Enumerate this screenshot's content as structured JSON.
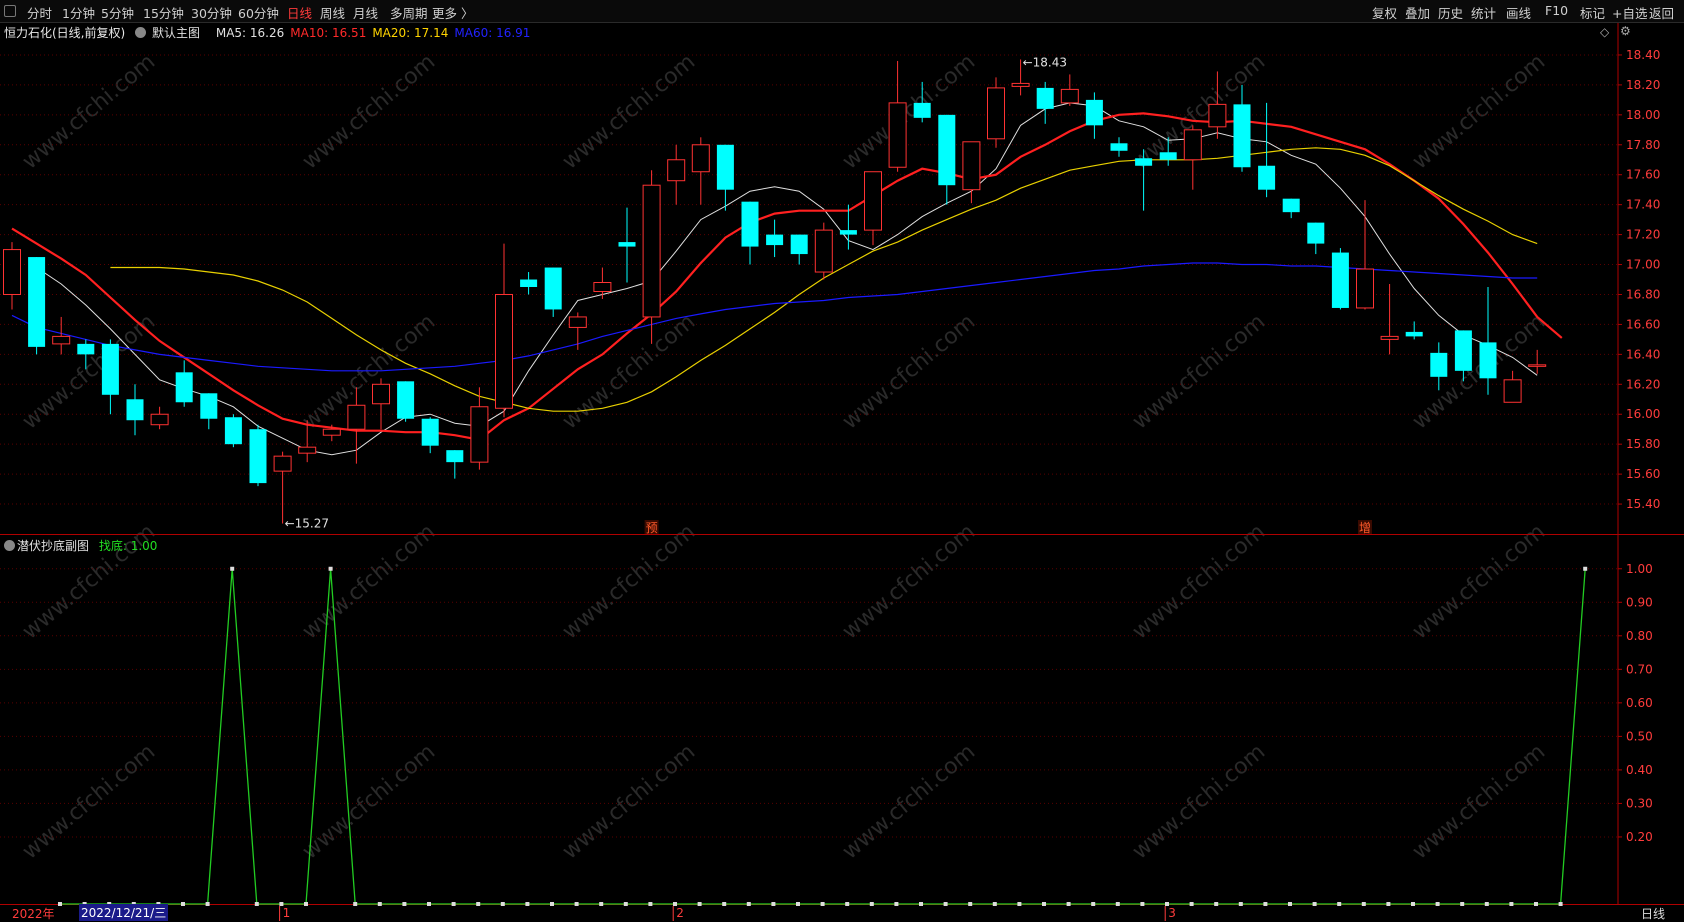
{
  "toolbar": {
    "periods": [
      "分时",
      "1分钟",
      "5分钟",
      "15分钟",
      "30分钟",
      "60分钟",
      "日线",
      "周线",
      "月线",
      "多周期",
      "更多 〉"
    ],
    "active_period": "日线",
    "right_buttons": [
      "复权",
      "叠加",
      "历史",
      "统计",
      "画线",
      "F10",
      "标记",
      "+自选",
      "返回"
    ]
  },
  "main_panel": {
    "stock_name": "恒力石化(日线,前复权)",
    "indicator_name": "默认主图",
    "ma_labels": [
      {
        "text": "MA5: 16.26",
        "color": "#e0e0e0"
      },
      {
        "text": "MA10: 16.51",
        "color": "#ff2a2a"
      },
      {
        "text": "MA20: 17.14",
        "color": "#ffd400"
      },
      {
        "text": "MA60: 16.91",
        "color": "#2222ff"
      }
    ],
    "high_marker": "18.43",
    "low_marker": "15.27",
    "event_markers": [
      "预",
      "增"
    ]
  },
  "sub_panel": {
    "indicator_name": "潜伏抄底副图",
    "value_label": "找底: 1.00"
  },
  "bottom_bar": {
    "year_label": "2022年",
    "cursor_date": "2022/12/21/三",
    "month_labels": [
      "1",
      "2",
      "3"
    ],
    "period_label": "日线"
  },
  "watermark": "www.cfchi.com",
  "colors": {
    "up_candle": "#ff3232",
    "down_candle": "#00ffff",
    "ma5": "#e0e0e0",
    "ma10": "#ff2020",
    "ma20": "#e8d000",
    "ma60": "#1a1aff",
    "signal_line": "#22cc22",
    "grid": "#8b0000",
    "axis_text": "#ff3c3c"
  },
  "chart_data": [
    {
      "type": "candlestick",
      "title": "恒力石化(日线,前复权)",
      "ylim": [
        15.2,
        18.5
      ],
      "yticks": [
        15.4,
        15.6,
        15.8,
        16.0,
        16.2,
        16.4,
        16.6,
        16.8,
        17.0,
        17.2,
        17.4,
        17.6,
        17.8,
        18.0,
        18.2,
        18.4
      ],
      "x_month_labels": [
        {
          "label": "1",
          "index": 11
        },
        {
          "label": "2",
          "index": 27
        },
        {
          "label": "3",
          "index": 47
        }
      ],
      "events": [
        {
          "label": "预",
          "index": 26
        },
        {
          "label": "增",
          "index": 55
        }
      ],
      "candles": [
        {
          "o": 16.8,
          "h": 17.15,
          "l": 16.7,
          "c": 17.1
        },
        {
          "o": 17.05,
          "h": 17.05,
          "l": 16.4,
          "c": 16.45
        },
        {
          "o": 16.47,
          "h": 16.65,
          "l": 16.4,
          "c": 16.52
        },
        {
          "o": 16.47,
          "h": 16.5,
          "l": 16.3,
          "c": 16.4
        },
        {
          "o": 16.47,
          "h": 16.5,
          "l": 16.0,
          "c": 16.13
        },
        {
          "o": 16.1,
          "h": 16.2,
          "l": 15.86,
          "c": 15.96
        },
        {
          "o": 15.93,
          "h": 16.05,
          "l": 15.9,
          "c": 16.0
        },
        {
          "o": 16.28,
          "h": 16.36,
          "l": 16.05,
          "c": 16.08
        },
        {
          "o": 16.14,
          "h": 16.14,
          "l": 15.9,
          "c": 15.97
        },
        {
          "o": 15.98,
          "h": 16.0,
          "l": 15.78,
          "c": 15.8
        },
        {
          "o": 15.9,
          "h": 15.93,
          "l": 15.52,
          "c": 15.54
        },
        {
          "o": 15.62,
          "h": 15.75,
          "l": 15.27,
          "c": 15.72
        },
        {
          "o": 15.74,
          "h": 15.96,
          "l": 15.68,
          "c": 15.78
        },
        {
          "o": 15.86,
          "h": 15.93,
          "l": 15.82,
          "c": 15.9
        },
        {
          "o": 15.9,
          "h": 16.18,
          "l": 15.67,
          "c": 16.06
        },
        {
          "o": 16.07,
          "h": 16.24,
          "l": 15.9,
          "c": 16.2
        },
        {
          "o": 16.22,
          "h": 16.22,
          "l": 15.95,
          "c": 15.97
        },
        {
          "o": 15.97,
          "h": 15.98,
          "l": 15.74,
          "c": 15.79
        },
        {
          "o": 15.76,
          "h": 15.76,
          "l": 15.57,
          "c": 15.68
        },
        {
          "o": 15.68,
          "h": 16.18,
          "l": 15.63,
          "c": 16.05
        },
        {
          "o": 16.04,
          "h": 17.14,
          "l": 15.98,
          "c": 16.8
        },
        {
          "o": 16.9,
          "h": 16.95,
          "l": 16.8,
          "c": 16.85
        },
        {
          "o": 16.98,
          "h": 16.98,
          "l": 16.65,
          "c": 16.7
        },
        {
          "o": 16.58,
          "h": 16.68,
          "l": 16.43,
          "c": 16.65
        },
        {
          "o": 16.82,
          "h": 16.98,
          "l": 16.77,
          "c": 16.88
        },
        {
          "o": 17.15,
          "h": 17.38,
          "l": 16.88,
          "c": 17.12
        },
        {
          "o": 16.65,
          "h": 17.63,
          "l": 16.47,
          "c": 17.53
        },
        {
          "o": 17.56,
          "h": 17.8,
          "l": 17.4,
          "c": 17.7
        },
        {
          "o": 17.62,
          "h": 17.85,
          "l": 17.4,
          "c": 17.8
        },
        {
          "o": 17.8,
          "h": 17.8,
          "l": 17.36,
          "c": 17.5
        },
        {
          "o": 17.42,
          "h": 17.42,
          "l": 17.0,
          "c": 17.12
        },
        {
          "o": 17.2,
          "h": 17.3,
          "l": 17.05,
          "c": 17.13
        },
        {
          "o": 17.2,
          "h": 17.2,
          "l": 17.0,
          "c": 17.07
        },
        {
          "o": 16.95,
          "h": 17.28,
          "l": 16.9,
          "c": 17.23
        },
        {
          "o": 17.23,
          "h": 17.4,
          "l": 17.1,
          "c": 17.2
        },
        {
          "o": 17.23,
          "h": 17.62,
          "l": 17.13,
          "c": 17.62
        },
        {
          "o": 17.65,
          "h": 18.36,
          "l": 17.62,
          "c": 18.08
        },
        {
          "o": 18.08,
          "h": 18.22,
          "l": 17.95,
          "c": 17.98
        },
        {
          "o": 18.0,
          "h": 18.0,
          "l": 17.4,
          "c": 17.53
        },
        {
          "o": 17.5,
          "h": 17.82,
          "l": 17.41,
          "c": 17.82
        },
        {
          "o": 17.84,
          "h": 18.25,
          "l": 17.78,
          "c": 18.18
        },
        {
          "o": 18.19,
          "h": 18.37,
          "l": 18.13,
          "c": 18.21
        },
        {
          "o": 18.18,
          "h": 18.22,
          "l": 17.94,
          "c": 18.04
        },
        {
          "o": 18.08,
          "h": 18.27,
          "l": 18.06,
          "c": 18.17
        },
        {
          "o": 18.1,
          "h": 18.15,
          "l": 17.84,
          "c": 17.93
        },
        {
          "o": 17.81,
          "h": 17.85,
          "l": 17.72,
          "c": 17.76
        },
        {
          "o": 17.71,
          "h": 17.77,
          "l": 17.36,
          "c": 17.66
        },
        {
          "o": 17.75,
          "h": 17.85,
          "l": 17.66,
          "c": 17.7
        },
        {
          "o": 17.7,
          "h": 17.93,
          "l": 17.5,
          "c": 17.9
        },
        {
          "o": 17.92,
          "h": 18.29,
          "l": 17.84,
          "c": 18.07
        },
        {
          "o": 18.07,
          "h": 18.2,
          "l": 17.62,
          "c": 17.65
        },
        {
          "o": 17.66,
          "h": 18.08,
          "l": 17.45,
          "c": 17.5
        },
        {
          "o": 17.44,
          "h": 17.44,
          "l": 17.31,
          "c": 17.35
        },
        {
          "o": 17.28,
          "h": 17.28,
          "l": 17.07,
          "c": 17.14
        },
        {
          "o": 17.08,
          "h": 17.11,
          "l": 16.7,
          "c": 16.71
        },
        {
          "o": 16.71,
          "h": 17.43,
          "l": 16.7,
          "c": 16.97
        },
        {
          "o": 16.5,
          "h": 16.87,
          "l": 16.4,
          "c": 16.52
        },
        {
          "o": 16.55,
          "h": 16.62,
          "l": 16.5,
          "c": 16.52
        },
        {
          "o": 16.41,
          "h": 16.48,
          "l": 16.16,
          "c": 16.25
        },
        {
          "o": 16.56,
          "h": 16.56,
          "l": 16.22,
          "c": 16.29
        },
        {
          "o": 16.48,
          "h": 16.85,
          "l": 16.13,
          "c": 16.24
        },
        {
          "o": 16.08,
          "h": 16.29,
          "l": 16.08,
          "c": 16.23
        },
        {
          "o": 16.32,
          "h": 16.43,
          "l": 16.27,
          "c": 16.33
        }
      ],
      "series": [
        {
          "name": "MA5",
          "values": [
            null,
            16.98,
            16.87,
            16.73,
            16.57,
            16.4,
            16.23,
            16.17,
            16.12,
            16.05,
            15.92,
            15.84,
            15.76,
            15.73,
            15.76,
            15.88,
            15.98,
            16.0,
            15.94,
            15.92,
            16.02,
            16.29,
            16.53,
            16.76,
            16.8,
            16.84,
            16.89,
            17.09,
            17.3,
            17.39,
            17.49,
            17.52,
            17.49,
            17.37,
            17.16,
            17.1,
            17.2,
            17.32,
            17.41,
            17.49,
            17.64,
            17.93,
            18.04,
            18.08,
            18.06,
            17.96,
            17.92,
            17.83,
            17.84,
            17.88,
            17.84,
            17.82,
            17.73,
            17.67,
            17.51,
            17.32,
            17.07,
            16.84,
            16.66,
            16.53,
            16.46,
            16.38,
            16.26
          ]
        },
        {
          "name": "MA10",
          "values": [
            17.24,
            17.14,
            17.04,
            16.93,
            16.78,
            16.63,
            16.49,
            16.38,
            16.27,
            16.16,
            16.06,
            15.97,
            15.93,
            15.91,
            15.89,
            15.89,
            15.88,
            15.88,
            15.86,
            15.83,
            15.96,
            16.04,
            16.17,
            16.3,
            16.4,
            16.54,
            16.67,
            16.82,
            17.01,
            17.18,
            17.28,
            17.34,
            17.36,
            17.36,
            17.36,
            17.46,
            17.56,
            17.64,
            17.61,
            17.57,
            17.6,
            17.72,
            17.8,
            17.89,
            17.96,
            18.0,
            18.01,
            17.99,
            17.96,
            17.95,
            17.96,
            17.94,
            17.92,
            17.87,
            17.82,
            17.77,
            17.67,
            17.56,
            17.44,
            17.27,
            17.08,
            16.87,
            16.65,
            16.51
          ]
        },
        {
          "name": "MA20",
          "values": [
            16.98,
            16.98,
            16.98,
            16.97,
            16.95,
            16.93,
            16.89,
            16.83,
            16.75,
            16.64,
            16.53,
            16.43,
            16.34,
            16.27,
            16.19,
            16.12,
            16.08,
            16.04,
            16.02,
            16.02,
            16.04,
            16.08,
            16.15,
            16.25,
            16.36,
            16.46,
            16.57,
            16.68,
            16.8,
            16.91,
            17.0,
            17.09,
            17.15,
            17.23,
            17.3,
            17.37,
            17.43,
            17.51,
            17.57,
            17.63,
            17.66,
            17.69,
            17.7,
            17.7,
            17.7,
            17.71,
            17.73,
            17.75,
            17.77,
            17.78,
            17.77,
            17.73,
            17.66,
            17.56,
            17.46,
            17.37,
            17.29,
            17.2,
            17.14
          ]
        },
        {
          "name": "MA60",
          "values": [
            16.66,
            16.58,
            16.54,
            16.5,
            16.46,
            16.43,
            16.4,
            16.38,
            16.36,
            16.34,
            16.32,
            16.31,
            16.3,
            16.29,
            16.29,
            16.29,
            16.3,
            16.31,
            16.32,
            16.34,
            16.36,
            16.39,
            16.43,
            16.47,
            16.52,
            16.56,
            16.6,
            16.64,
            16.67,
            16.7,
            16.72,
            16.74,
            16.75,
            16.76,
            16.78,
            16.79,
            16.8,
            16.82,
            16.84,
            16.86,
            16.88,
            16.9,
            16.92,
            16.94,
            16.96,
            16.97,
            16.99,
            17.0,
            17.01,
            17.01,
            17.0,
            17.0,
            16.99,
            16.99,
            16.98,
            16.97,
            16.96,
            16.95,
            16.94,
            16.93,
            16.92,
            16.91,
            16.91
          ]
        }
      ]
    },
    {
      "type": "line",
      "title": "潜伏抄底副图",
      "ylim": [
        0.0,
        1.05
      ],
      "yticks": [
        0.2,
        0.3,
        0.4,
        0.5,
        0.6,
        0.7,
        0.8,
        0.9,
        1.0
      ],
      "series": [
        {
          "name": "找底",
          "values": [
            0,
            0,
            0,
            0,
            0,
            0,
            0,
            1,
            0,
            0,
            0,
            1,
            0,
            0,
            0,
            0,
            0,
            0,
            0,
            0,
            0,
            0,
            0,
            0,
            0,
            0,
            0,
            0,
            0,
            0,
            0,
            0,
            0,
            0,
            0,
            0,
            0,
            0,
            0,
            0,
            0,
            0,
            0,
            0,
            0,
            0,
            0,
            0,
            0,
            0,
            0,
            0,
            0,
            0,
            0,
            0,
            0,
            0,
            0,
            0,
            0,
            0,
            1
          ]
        }
      ]
    }
  ]
}
